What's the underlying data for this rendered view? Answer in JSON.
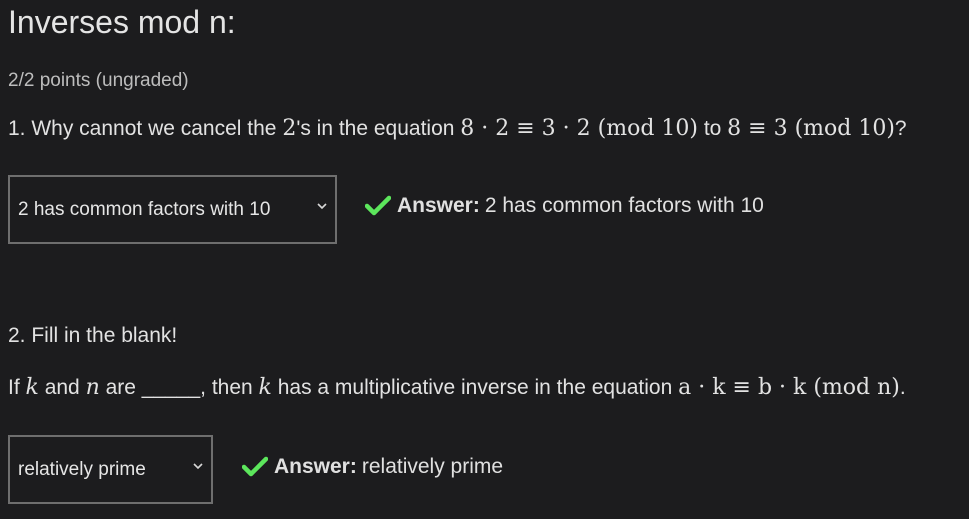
{
  "page": {
    "title": "Inverses mod n:",
    "points": "2/2 points (ungraded)"
  },
  "q1": {
    "prefix": "1. Why cannot we cancel the ",
    "math_two": "2",
    "mid1": "'s in the equation ",
    "eq1": "8 · 2 ≡ 3 · 2 (mod 10)",
    "mid2": " to ",
    "eq2": "8 ≡ 3 (mod 10)",
    "suffix": "?",
    "selected": "2 has common factors with 10",
    "answer_label": "Answer:",
    "answer_value": "2 has common factors with 10"
  },
  "q2": {
    "label": "2. Fill in the blank!",
    "t1": "If ",
    "k": "k",
    "t2": " and ",
    "n": "n",
    "t3": " are _____, then ",
    "t4": " has a multiplicative inverse in the equation ",
    "eq": "a · k ≡ b · k (mod n)",
    "t5": ".",
    "selected": "relatively prime",
    "answer_label": "Answer:",
    "answer_value": "relatively prime"
  },
  "colors": {
    "background": "#1c1c1e",
    "check": "#5ce65c",
    "select_border": "#6e6e6e"
  },
  "icons": {
    "dropdown": "chevron-down-icon",
    "correct": "checkmark-icon"
  }
}
